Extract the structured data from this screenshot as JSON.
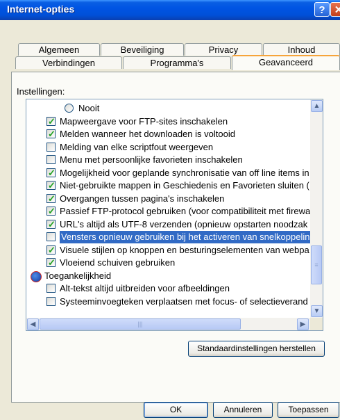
{
  "window": {
    "title": "Internet-opties"
  },
  "titlebar": {
    "help_label": "?",
    "close_label": "✕"
  },
  "tabs_row1": [
    "Algemeen",
    "Beveiliging",
    "Privacy",
    "Inhoud"
  ],
  "tabs_row2": [
    "Verbindingen",
    "Programma's",
    "Geavanceerd"
  ],
  "active_tab": "Geavanceerd",
  "settings_label": "Instellingen:",
  "items": [
    {
      "type": "radio",
      "label": "Nooit",
      "checked": false,
      "indent": 1
    },
    {
      "type": "checkbox",
      "label": "Mapweergave voor FTP-sites inschakelen",
      "checked": true,
      "indent": 0
    },
    {
      "type": "checkbox",
      "label": "Melden wanneer het downloaden is voltooid",
      "checked": true,
      "indent": 0
    },
    {
      "type": "checkbox",
      "label": "Melding van elke scriptfout weergeven",
      "checked": false,
      "indent": 0
    },
    {
      "type": "checkbox",
      "label": "Menu met persoonlijke favorieten inschakelen",
      "checked": false,
      "indent": 0
    },
    {
      "type": "checkbox",
      "label": "Mogelijkheid voor geplande synchronisatie van off line items in",
      "checked": true,
      "indent": 0
    },
    {
      "type": "checkbox",
      "label": "Niet-gebruikte mappen in Geschiedenis en Favorieten sluiten (",
      "checked": true,
      "indent": 0
    },
    {
      "type": "checkbox",
      "label": "Overgangen tussen pagina's inschakelen",
      "checked": true,
      "indent": 0
    },
    {
      "type": "checkbox",
      "label": "Passief FTP-protocol gebruiken (voor compatibiliteit met firewa",
      "checked": true,
      "indent": 0
    },
    {
      "type": "checkbox",
      "label": "URL's altijd als UTF-8 verzenden (opnieuw opstarten noodzak",
      "checked": true,
      "indent": 0
    },
    {
      "type": "checkbox",
      "label": "Vensters opnieuw gebruiken bij het activeren van snelkoppelin",
      "checked": false,
      "indent": 0,
      "selected": true
    },
    {
      "type": "checkbox",
      "label": "Visuele stijlen op knoppen en besturingselementen van webpa",
      "checked": true,
      "indent": 0
    },
    {
      "type": "checkbox",
      "label": "Vloeiend schuiven gebruiken",
      "checked": true,
      "indent": 0
    },
    {
      "type": "group",
      "label": "Toegankelijkheid",
      "indent": -1
    },
    {
      "type": "checkbox",
      "label": "Alt-tekst altijd uitbreiden voor afbeeldingen",
      "checked": false,
      "indent": 0
    },
    {
      "type": "checkbox",
      "label": "Systeeminvoegteken verplaatsen met focus- of selectieverand",
      "checked": false,
      "indent": 0
    }
  ],
  "scroll_arrows": {
    "up": "▲",
    "down": "▼",
    "left": "◀",
    "right": "▶"
  },
  "restore_defaults_label": "Standaardinstellingen herstellen",
  "buttons": {
    "ok": "OK",
    "cancel": "Annuleren",
    "apply": "Toepassen"
  }
}
